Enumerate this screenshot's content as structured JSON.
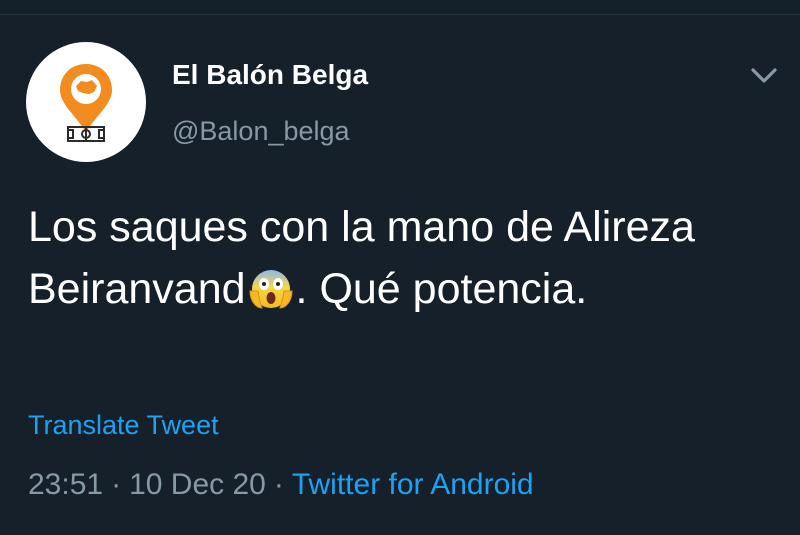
{
  "tweet": {
    "author": {
      "display_name": "El Balón Belga",
      "handle": "@Balon_belga",
      "avatar_icon": "balon-belga-logo"
    },
    "text_before_emoji": "Los saques con la mano de Alireza Beiranvand",
    "emoji": "face-screaming-in-fear",
    "text_after_emoji": ". Qué potencia.",
    "translate_label": "Translate Tweet",
    "time": "23:51",
    "separator": "·",
    "date": "10 Dec 20",
    "source": "Twitter for Android",
    "menu_icon": "chevron-down-icon"
  },
  "colors": {
    "background": "#15202b",
    "text_primary": "#ffffff",
    "text_secondary": "#8899a6",
    "link": "#1da1f2",
    "logo_orange": "#f28c1e",
    "logo_dark": "#2b2b2b"
  }
}
